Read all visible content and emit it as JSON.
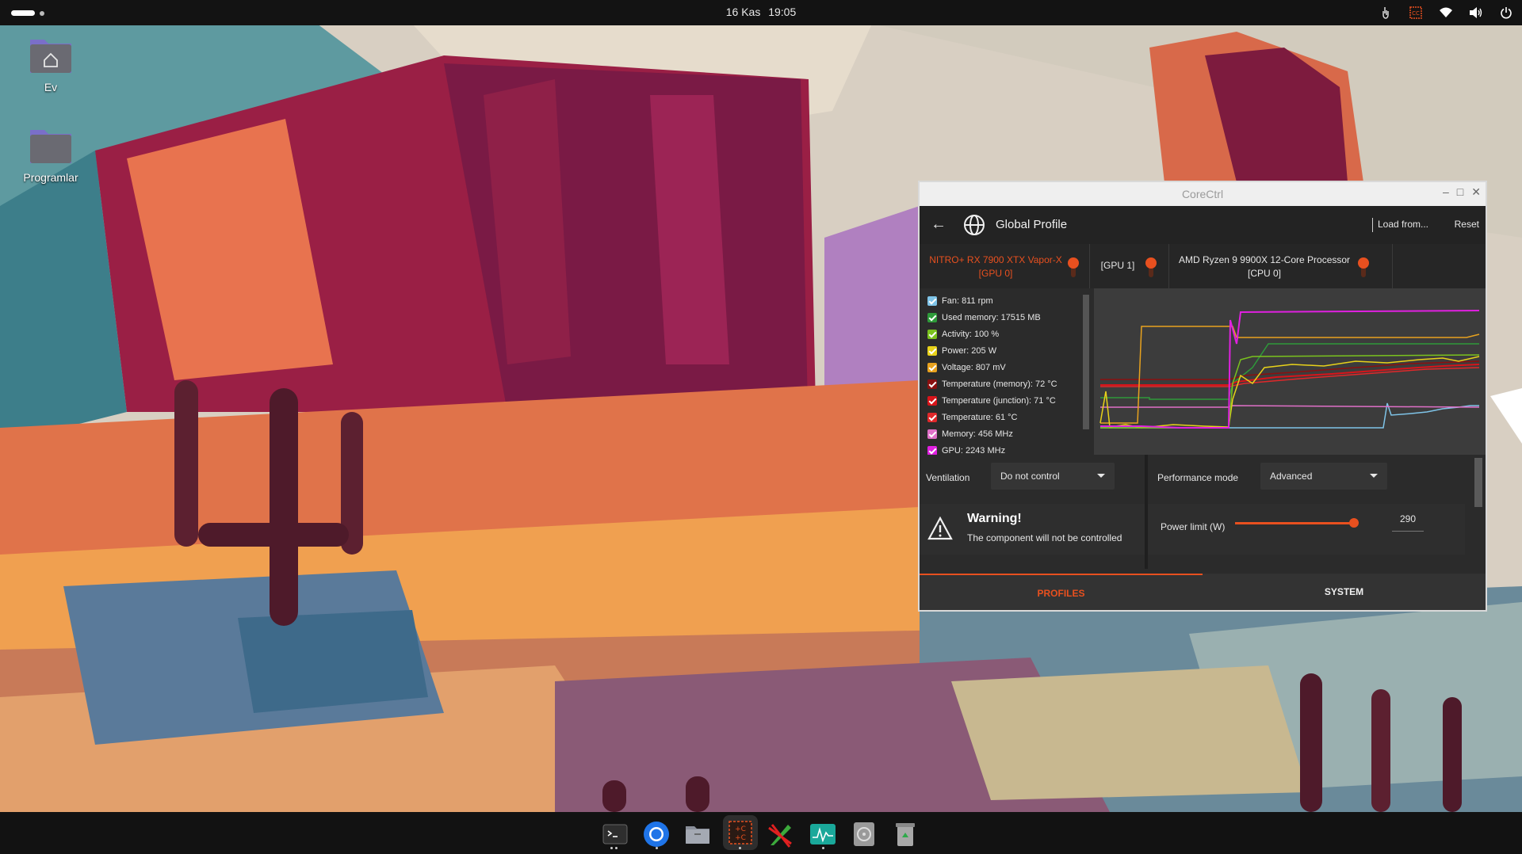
{
  "top_panel": {
    "date": "16 Kas",
    "time": "19:05",
    "tray_icons": [
      "hand-pointer-icon",
      "corectrl-tray-icon",
      "wifi-icon",
      "volume-icon",
      "power-icon"
    ]
  },
  "desktop": {
    "icons": [
      {
        "label": "Ev",
        "icon": "home-folder-icon"
      },
      {
        "label": "Programlar",
        "icon": "folder-icon"
      }
    ]
  },
  "window": {
    "title": "CoreCtrl",
    "toolbar": {
      "profile_title": "Global Profile",
      "load_label": "Load from...",
      "reset_label": "Reset"
    },
    "tabs": [
      {
        "line1": "NITRO+ RX 7900 XTX Vapor-X",
        "line2": "[GPU 0]",
        "active": true
      },
      {
        "line1": "[GPU 1]",
        "line2": "",
        "active": false
      },
      {
        "line1": "AMD Ryzen 9 9900X 12-Core Processor",
        "line2": "[CPU 0]",
        "active": false
      }
    ],
    "sensors": [
      {
        "label": "Fan: 811 rpm",
        "color": "#7fc4e8"
      },
      {
        "label": "Used memory: 17515 MB",
        "color": "#2e9a3a"
      },
      {
        "label": "Activity: 100 %",
        "color": "#7ac21e"
      },
      {
        "label": "Power: 205 W",
        "color": "#e8d21a"
      },
      {
        "label": "Voltage: 807 mV",
        "color": "#e8a21e"
      },
      {
        "label": "Temperature (memory): 72 °C",
        "color": "#8a1010"
      },
      {
        "label": "Temperature (junction): 71 °C",
        "color": "#d8141a"
      },
      {
        "label": "Temperature: 61 °C",
        "color": "#e0282a"
      },
      {
        "label": "Memory: 456 MHz",
        "color": "#e070c8"
      },
      {
        "label": "GPU: 2243 MHz",
        "color": "#e020e0"
      }
    ],
    "controls": {
      "ventilation_label": "Ventilation",
      "ventilation_value": "Do not control",
      "performance_label": "Performance mode",
      "performance_value": "Advanced",
      "warning_title": "Warning!",
      "warning_text": "The component will not be controlled",
      "power_limit_label": "Power limit (W)",
      "power_limit_value": "290",
      "power_limit_fraction": 1.0
    },
    "bottom_tabs": {
      "profiles": "PROFILES",
      "system": "SYSTEM"
    },
    "accent_color": "#e8501f"
  },
  "dock": {
    "items": [
      {
        "name": "terminal",
        "icon": "terminal-icon",
        "running": true,
        "dots": 2
      },
      {
        "name": "chromium",
        "icon": "chromium-icon",
        "running": true,
        "dots": 1
      },
      {
        "name": "files",
        "icon": "files-icon",
        "running": false,
        "dots": 0
      },
      {
        "name": "corectrl",
        "icon": "corectrl-icon",
        "running": true,
        "dots": 1
      },
      {
        "name": "apostrophe",
        "icon": "quill-icon",
        "running": false,
        "dots": 0
      },
      {
        "name": "system-monitor",
        "icon": "system-monitor-icon",
        "running": true,
        "dots": 1
      },
      {
        "name": "disks",
        "icon": "disks-icon",
        "running": false,
        "dots": 0
      },
      {
        "name": "trash",
        "icon": "trash-icon",
        "running": false,
        "dots": 0
      }
    ]
  }
}
